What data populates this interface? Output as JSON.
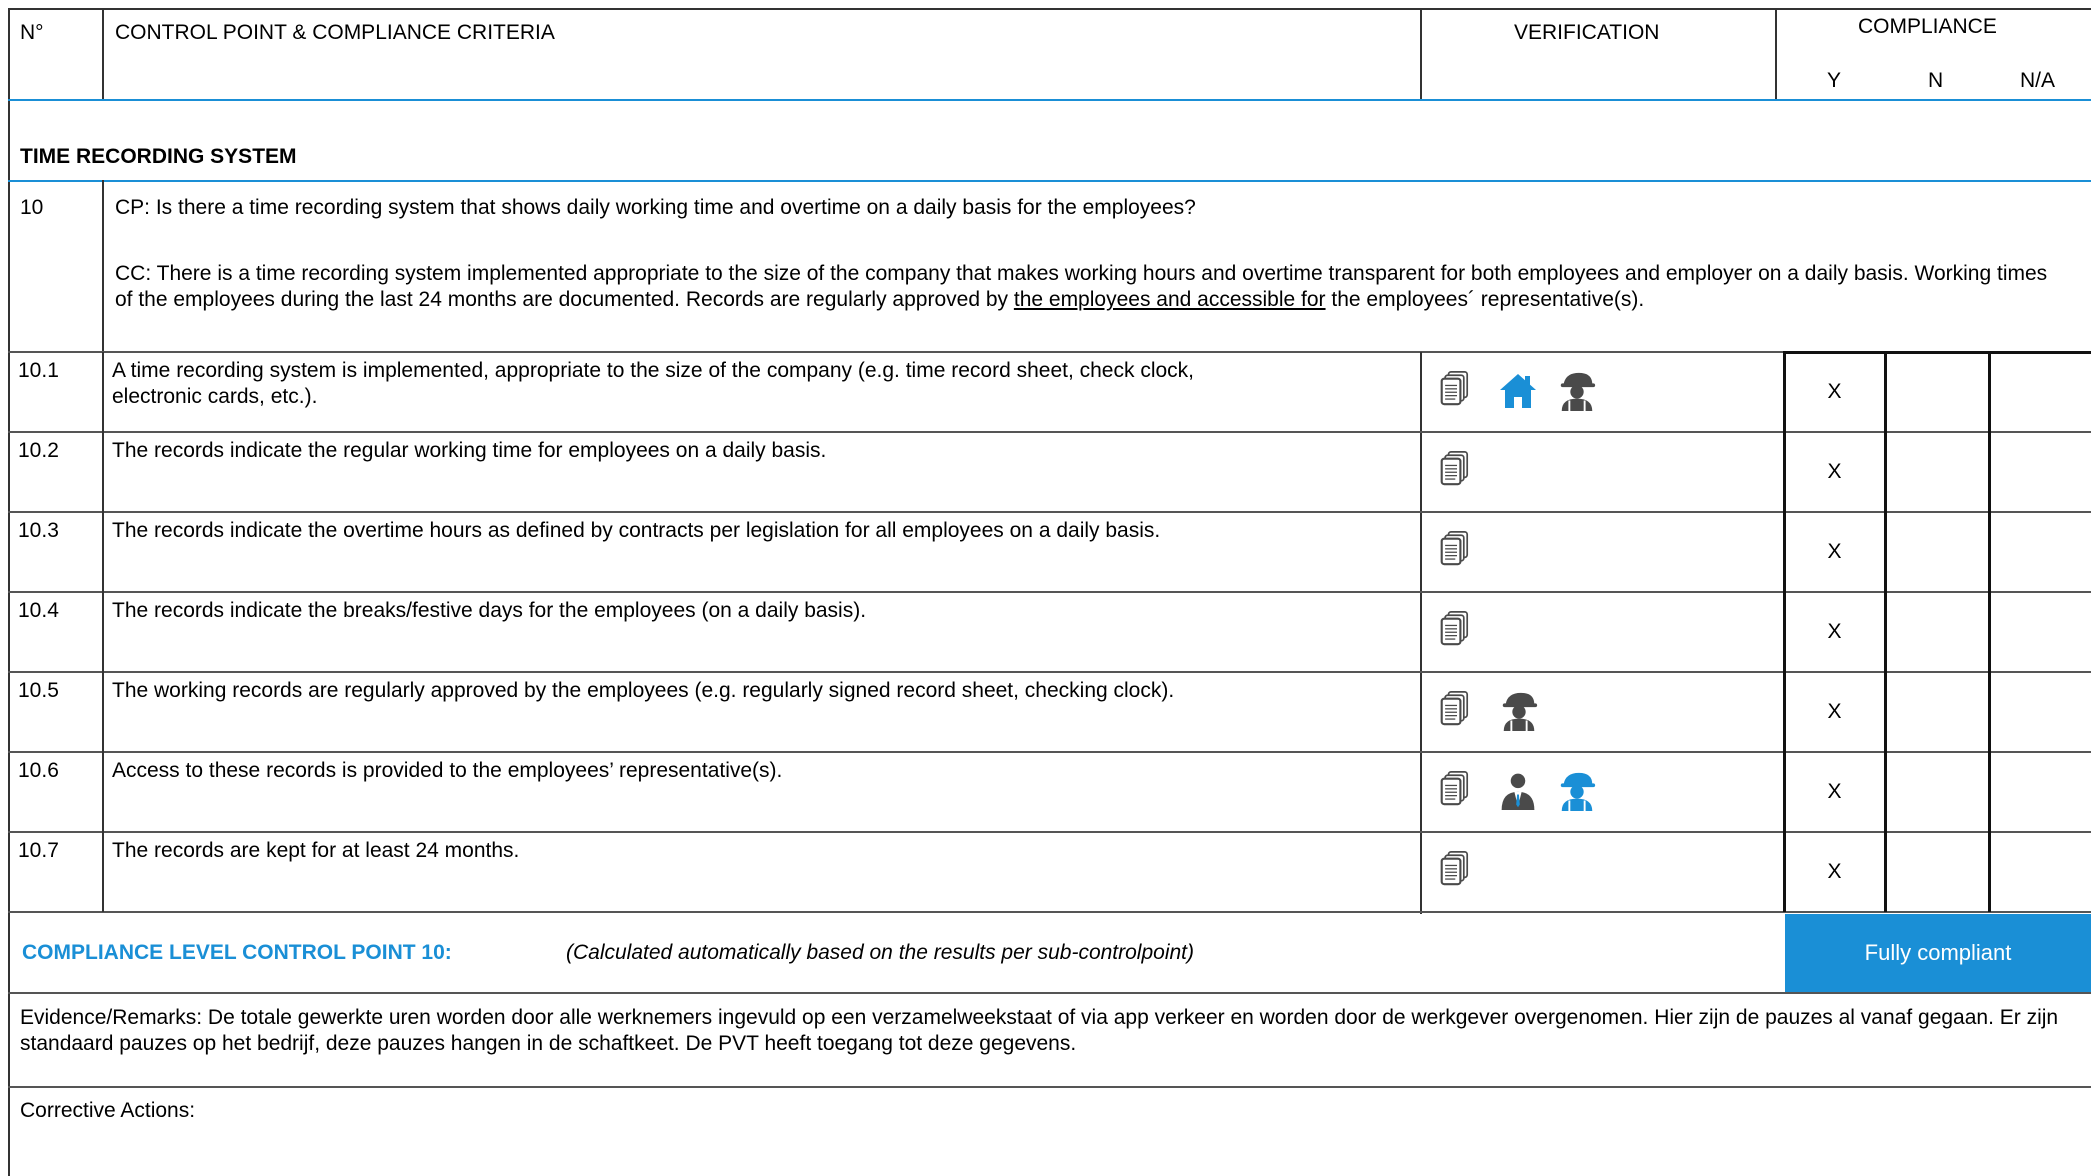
{
  "header": {
    "no": "N°",
    "control": "CONTROL POINT & COMPLIANCE CRITERIA",
    "verification": "VERIFICATION",
    "compliance": "COMPLIANCE",
    "y": "Y",
    "n": "N",
    "na": "N/A"
  },
  "section_title": "TIME RECORDING SYSTEM",
  "cp": {
    "number": "10",
    "question": "CP: Is there a time recording system that shows daily working time and overtime on a daily basis for the employees?",
    "cc_part1": "CC: There is a time recording system implemented appropriate to the size of the company that makes working hours and overtime transparent for both employees and employer on a daily basis. Working times of the employees during the last 24 months are documented. Records are regularly approved by",
    "cc_underlined": "the employees and accessible for",
    "cc_part2": "the employees´ representative(s)."
  },
  "rows": [
    {
      "no": "10.1",
      "text_line1": "A time recording system is implemented, appropriate to the size of the company (e.g. time record sheet, check clock,",
      "text_line2": "electronic cards, etc.).",
      "icons": [
        "document-icon",
        "home-icon",
        "worker-icon"
      ],
      "y": "X",
      "n": "",
      "na": ""
    },
    {
      "no": "10.2",
      "text_line1": "The records indicate the regular working time for employees on a daily basis.",
      "text_line2": "",
      "icons": [
        "document-icon"
      ],
      "y": "X",
      "n": "",
      "na": ""
    },
    {
      "no": "10.3",
      "text_line1": "The records indicate the overtime hours as defined by contracts per legislation for all employees on a daily basis.",
      "text_line2": "",
      "icons": [
        "document-icon"
      ],
      "y": "X",
      "n": "",
      "na": ""
    },
    {
      "no": "10.4",
      "text_line1": "The records indicate the breaks/festive days for the employees (on a daily basis).",
      "text_line2": "",
      "icons": [
        "document-icon"
      ],
      "y": "X",
      "n": "",
      "na": ""
    },
    {
      "no": "10.5",
      "text_line1": "The working records are regularly approved by the employees (e.g. regularly signed record sheet, checking clock).",
      "text_line2": "",
      "icons": [
        "document-icon",
        "worker-icon"
      ],
      "y": "X",
      "n": "",
      "na": ""
    },
    {
      "no": "10.6",
      "text_line1": "Access to these records is provided to the employees’ representative(s).",
      "text_line2": "",
      "icons": [
        "document-icon",
        "manager-icon",
        "worker-blue-icon"
      ],
      "y": "X",
      "n": "",
      "na": ""
    },
    {
      "no": "10.7",
      "text_line1": "The records are kept for at least 24 months.",
      "text_line2": "",
      "icons": [
        "document-icon"
      ],
      "y": "X",
      "n": "",
      "na": ""
    }
  ],
  "compliance_level": {
    "label": "COMPLIANCE LEVEL CONTROL POINT 10:",
    "note": "(Calculated automatically based on the results per sub-controlpoint)",
    "result": "Fully compliant"
  },
  "evidence": {
    "text": "Evidence/Remarks: De totale gewerkte uren worden door alle werknemers ingevuld op een verzamelweekstaat of via app verkeer en worden door de werkgever overgenomen. Hier zijn de pauzes al vanaf gegaan. Er zijn standaard pauzes op het bedrijf, deze pauzes hangen in de schaftkeet. De PVT heeft toegang tot deze gegevens."
  },
  "corrective": {
    "label": "Corrective Actions:"
  },
  "colors": {
    "accent": "#1a8fd6",
    "icon_dark": "#4a4a4a"
  }
}
